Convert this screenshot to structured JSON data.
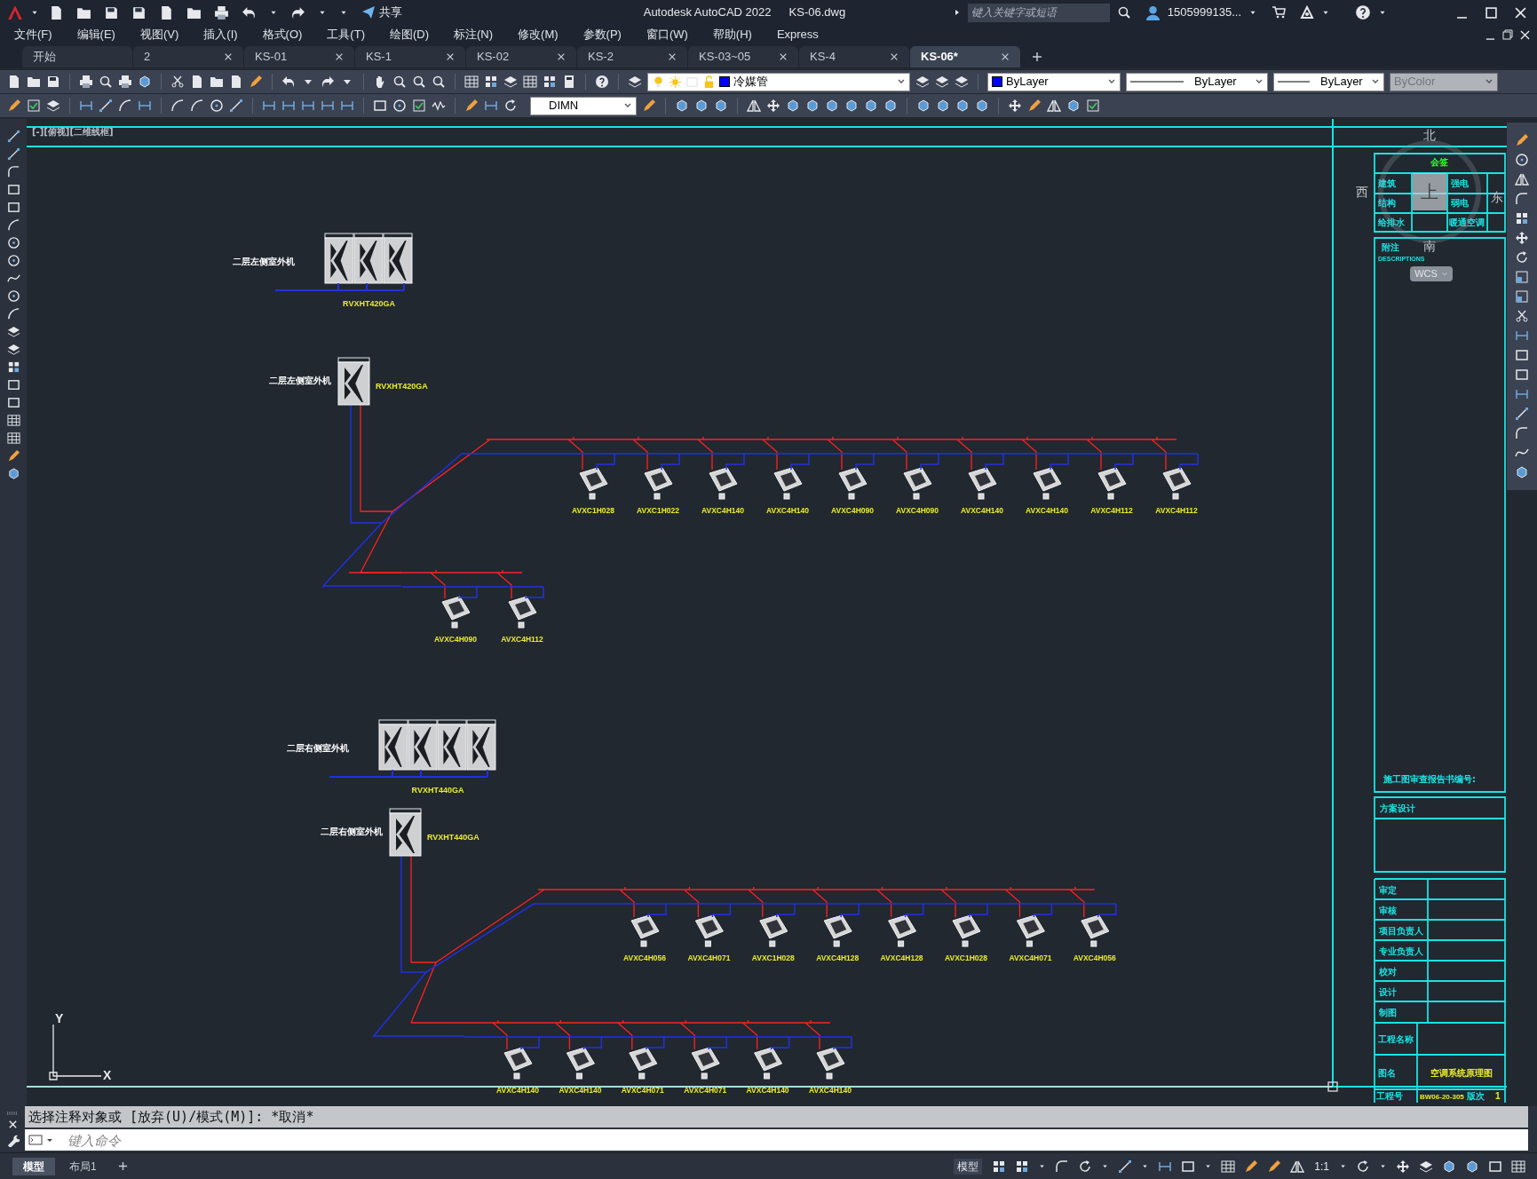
{
  "title_bar": {
    "app_title": "Autodesk AutoCAD 2022",
    "file_name": "KS-06.dwg",
    "share": "共享",
    "search": {
      "placeholder": "键入关键字或短语"
    },
    "user": "1505999135..."
  },
  "menu": [
    "文件(F)",
    "编辑(E)",
    "视图(V)",
    "插入(I)",
    "格式(O)",
    "工具(T)",
    "绘图(D)",
    "标注(N)",
    "修改(M)",
    "参数(P)",
    "窗口(W)",
    "帮助(H)",
    "Express"
  ],
  "tabs": [
    {
      "label": "开始",
      "selected": false,
      "closable": false
    },
    {
      "label": "2",
      "selected": false,
      "closable": true
    },
    {
      "label": "KS-01",
      "selected": false,
      "closable": true
    },
    {
      "label": "KS-1",
      "selected": false,
      "closable": true
    },
    {
      "label": "KS-02",
      "selected": false,
      "closable": true
    },
    {
      "label": "KS-2",
      "selected": false,
      "closable": true
    },
    {
      "label": "KS-03~05",
      "selected": false,
      "closable": true
    },
    {
      "label": "KS-4",
      "selected": false,
      "closable": true
    },
    {
      "label": "KS-06*",
      "selected": true,
      "closable": true
    }
  ],
  "toolbar": {
    "layer": {
      "name": "冷媒管",
      "color": "#0000ff"
    },
    "color": {
      "value": "ByLayer",
      "color": "#0000ff"
    },
    "linetype": "ByLayer",
    "lineweight": "ByLayer",
    "plot_style": {
      "value": "ByColor",
      "disabled": true
    },
    "dim_style": "DIMN"
  },
  "viewport_label": "[-][俯视][二维线框]",
  "viewcube": {
    "top": "上",
    "north": "北",
    "east": "东",
    "south": "南",
    "west": "西",
    "ucs": "WCS"
  },
  "drawing": {
    "groups": [
      {
        "outdoor_units": [
          {
            "kind": "bank-3",
            "label": "二层左侧室外机",
            "model": "RVXHT420GA"
          },
          {
            "kind": "single",
            "label": "二层左侧室外机",
            "model": "RVXHT420GA"
          }
        ],
        "branches": [
          {
            "units": [
              "AVXC1H028",
              "AVXC1H022",
              "AVXC4H140",
              "AVXC4H140",
              "AVXC4H090",
              "AVXC4H090",
              "AVXC4H140",
              "AVXC4H140",
              "AVXC4H112",
              "AVXC4H112"
            ]
          },
          {
            "units": [
              "AVXC4H090",
              "AVXC4H112"
            ]
          }
        ]
      },
      {
        "outdoor_units": [
          {
            "kind": "bank-4",
            "label": "二层右侧室外机",
            "model": "RVXHT440GA"
          },
          {
            "kind": "single",
            "label": "二层右侧室外机",
            "model": "RVXHT440GA"
          }
        ],
        "branches": [
          {
            "units": [
              "AVXC4H056",
              "AVXC4H071",
              "AVXC1H028",
              "AVXC4H128",
              "AVXC4H128",
              "AVXC1H028",
              "AVXC4H071",
              "AVXC4H056"
            ]
          },
          {
            "units": [
              "AVXC4H140",
              "AVXC4H140",
              "AVXC4H071",
              "AVXC4H071",
              "AVXC4H140",
              "AVXC4H140"
            ]
          }
        ]
      }
    ],
    "axis": {
      "y": "Y",
      "x": "X"
    }
  },
  "title_block": {
    "sign_header": "会签",
    "disciplines": [
      "建筑",
      "强电",
      "结构",
      "弱电",
      "给排水",
      "暖通空调"
    ],
    "notes_title": "附注",
    "notes_subtitle": "DESCRIPTIONS",
    "review_no": "施工图审查报告书编号:",
    "scheme": "方案设计",
    "roles": [
      "审定",
      "审核",
      "项目负责人",
      "专业负责人",
      "校对",
      "设计",
      "制图"
    ],
    "project_name": "工程名称",
    "drawing_name_label": "图名",
    "drawing_name": "空调系统原理图",
    "project_no_label": "工程号",
    "project_no": "BW06-20-305",
    "revision_label": "版次",
    "revision": "1"
  },
  "command": {
    "history": "选择注释对象或 [放弃(U)/模式(M)]: *取消*",
    "input": {
      "placeholder": "键入命令"
    }
  },
  "layout_tabs": [
    {
      "label": "模型",
      "selected": true
    },
    {
      "label": "布局1",
      "selected": false
    }
  ],
  "status_bar": {
    "space": "模型",
    "scale": "1:1"
  }
}
